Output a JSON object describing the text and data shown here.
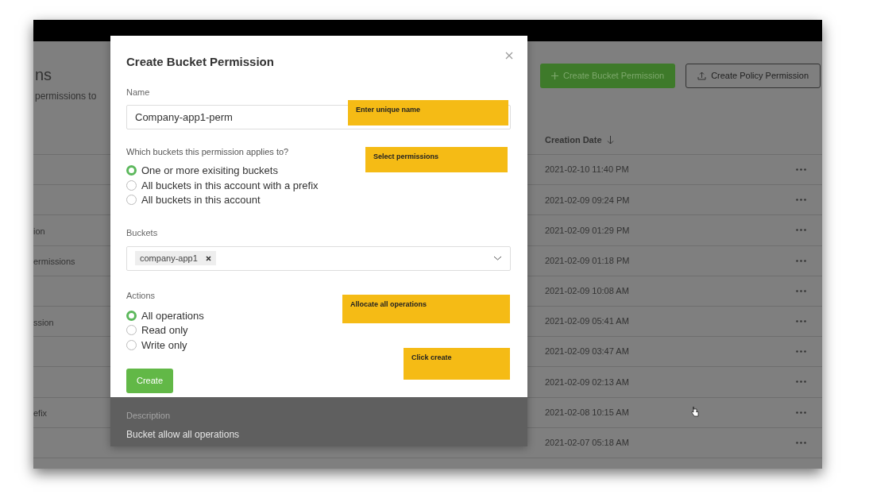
{
  "page": {
    "title": "ns",
    "subtitle": "permissions to",
    "buttons": [
      {
        "label": "Create Bucket Permission",
        "kind": "primary"
      },
      {
        "label": "Create Policy Permission",
        "kind": "outline"
      }
    ],
    "table": {
      "columns": [
        {
          "label": "Creation Date"
        }
      ],
      "rows": [
        {
          "date": "2021-02-10 11:40 PM"
        },
        {
          "date": "2021-02-09 09:24 PM"
        },
        {
          "name": "ion",
          "date": "2021-02-09 01:29 PM"
        },
        {
          "name": "ermissions",
          "date": "2021-02-09 01:18 PM"
        },
        {
          "date": "2021-02-09 10:08 AM"
        },
        {
          "name": "ssion",
          "date": "2021-02-09 05:41 AM"
        },
        {
          "date": "2021-02-09 03:47 AM"
        },
        {
          "date": "2021-02-09 02:13 AM"
        },
        {
          "name": "efix",
          "date": "2021-02-08 10:15 AM"
        },
        {
          "date": "2021-02-07 05:18 AM"
        }
      ]
    }
  },
  "dialog": {
    "title": "Create Bucket Permission",
    "name_field": {
      "label": "Name",
      "value": "Company-app1-perm"
    },
    "scope": {
      "label": "Which buckets this permission applies to?",
      "options": [
        {
          "label": "One or more exisiting buckets",
          "selected": true
        },
        {
          "label": "All buckets in this account with a prefix",
          "selected": false
        },
        {
          "label": "All buckets in this account",
          "selected": false
        }
      ]
    },
    "buckets": {
      "label": "Buckets",
      "chips": [
        "company-app1"
      ]
    },
    "actions": {
      "label": "Actions",
      "options": [
        {
          "label": "All operations",
          "selected": true
        },
        {
          "label": "Read only",
          "selected": false
        },
        {
          "label": "Write only",
          "selected": false
        }
      ]
    },
    "create_button": "Create",
    "description": {
      "label": "Description",
      "text": "Bucket allow all operations"
    }
  },
  "annotations": [
    {
      "text": "Enter unique name"
    },
    {
      "text": "Select permissions"
    },
    {
      "text": "Allocate all operations"
    },
    {
      "text": "Click create"
    }
  ]
}
